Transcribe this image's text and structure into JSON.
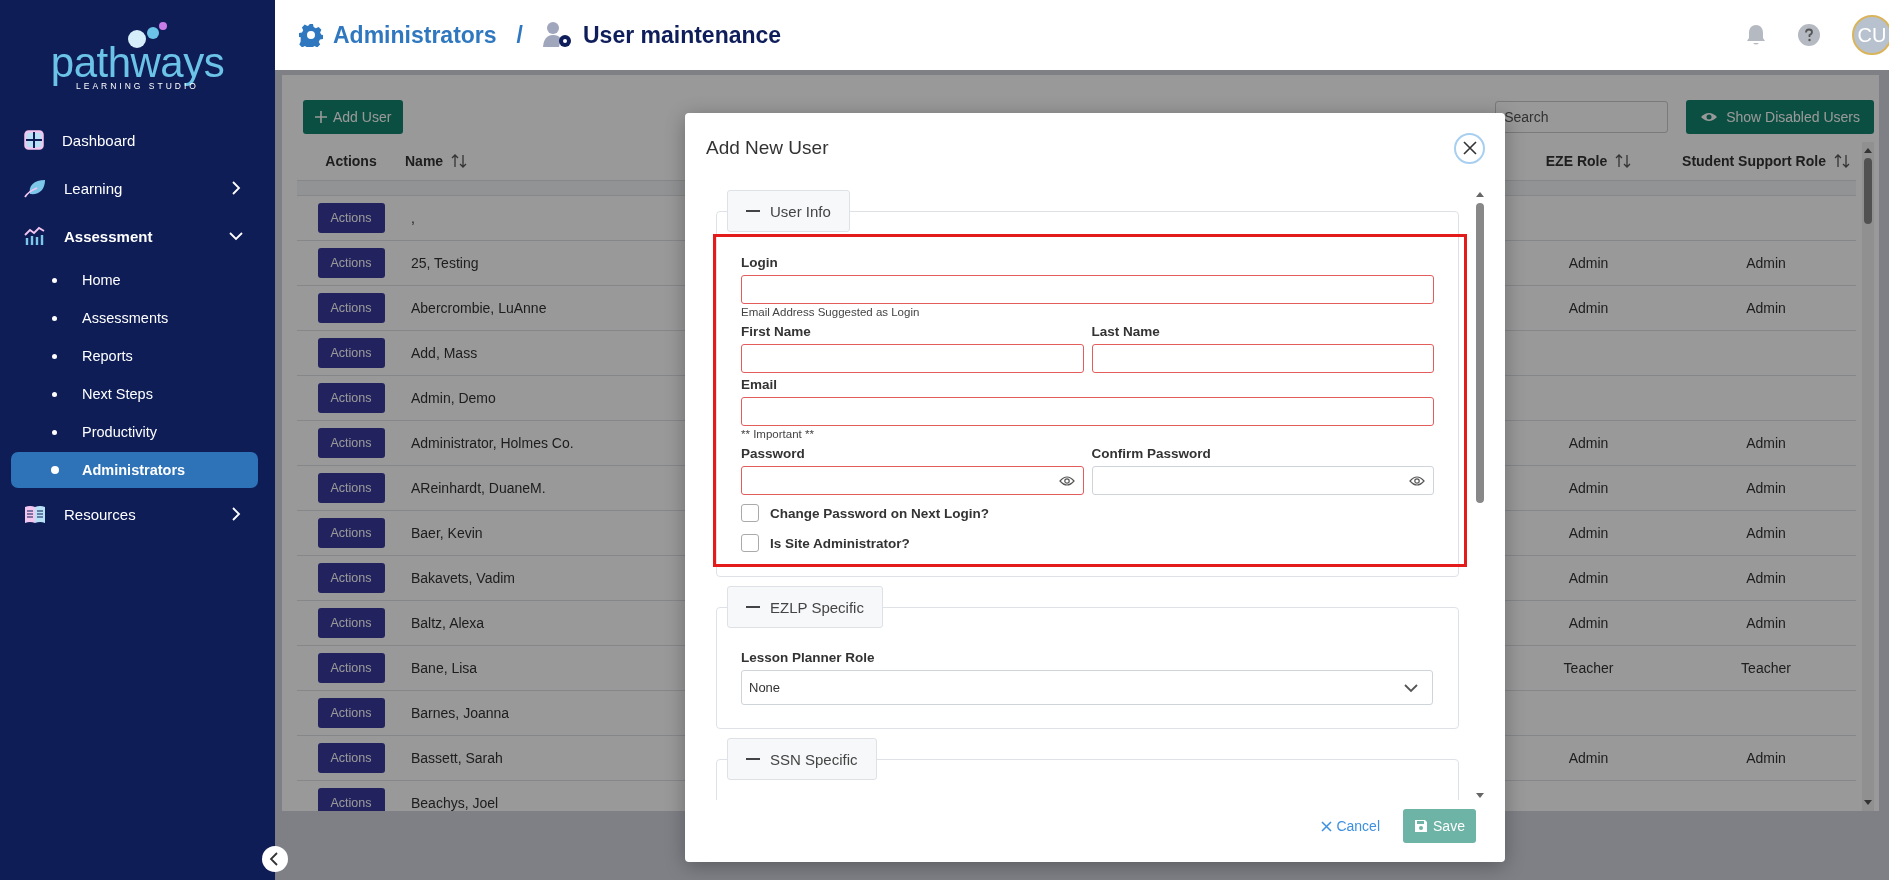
{
  "sidebar": {
    "logo": {
      "name": "pathways",
      "tagline": "LEARNING STUDIO"
    },
    "items": [
      {
        "label": "Dashboard"
      },
      {
        "label": "Learning",
        "expanded": false
      },
      {
        "label": "Assessment",
        "expanded": true,
        "children": [
          {
            "label": "Home",
            "selected": false
          },
          {
            "label": "Assessments",
            "selected": false
          },
          {
            "label": "Reports",
            "selected": false
          },
          {
            "label": "Next Steps",
            "selected": false
          },
          {
            "label": "Productivity",
            "selected": false
          },
          {
            "label": "Administrators",
            "selected": true
          }
        ]
      },
      {
        "label": "Resources",
        "expanded": false
      }
    ]
  },
  "header": {
    "breadcrumb": [
      {
        "label": "Administrators"
      },
      {
        "label": "User maintenance"
      }
    ],
    "separator": "/",
    "avatar": "CU"
  },
  "toolbar": {
    "add_button": "Add User",
    "search": {
      "placeholder": "Search"
    },
    "show_disabled_button": "Show Disabled Users"
  },
  "table": {
    "columns": [
      {
        "label": "Actions",
        "sortable": false
      },
      {
        "label": "Name",
        "sortable": true
      },
      {
        "label": "EZE Role",
        "sortable": true
      },
      {
        "label": "Student Support Role",
        "sortable": true
      }
    ],
    "rows": [
      {
        "action": "Actions",
        "name": ","
      },
      {
        "action": "Actions",
        "name": "25, Testing",
        "eze_role": "Admin",
        "support_role": "Admin"
      },
      {
        "action": "Actions",
        "name": "Abercrombie, LuAnne",
        "eze_role": "Admin",
        "support_role": "Admin"
      },
      {
        "action": "Actions",
        "name": "Add, Mass"
      },
      {
        "action": "Actions",
        "name": "Admin, Demo"
      },
      {
        "action": "Actions",
        "name": "Administrator, Holmes Co.",
        "eze_role": "Admin",
        "support_role": "Admin"
      },
      {
        "action": "Actions",
        "name": "AReinhardt, DuaneM.",
        "eze_role": "Admin",
        "support_role": "Admin"
      },
      {
        "action": "Actions",
        "name": "Baer, Kevin",
        "eze_role": "Admin",
        "support_role": "Admin"
      },
      {
        "action": "Actions",
        "name": "Bakavets, Vadim",
        "eze_role": "Admin",
        "support_role": "Admin"
      },
      {
        "action": "Actions",
        "name": "Baltz, Alexa",
        "eze_role": "Admin",
        "support_role": "Admin"
      },
      {
        "action": "Actions",
        "name": "Bane, Lisa",
        "eze_role": "Teacher",
        "support_role": "Teacher"
      },
      {
        "action": "Actions",
        "name": "Barnes, Joanna"
      },
      {
        "action": "Actions",
        "name": "Bassett, Sarah",
        "eze_role": "Admin",
        "support_role": "Admin"
      },
      {
        "action": "Actions",
        "name": "Beachys, Joel"
      }
    ]
  },
  "modal": {
    "title": "Add New User",
    "user_info": {
      "legend": "User Info",
      "expanded": true,
      "rows": [
        {
          "fields": [
            {
              "label": "Login",
              "kind": "text",
              "invalid": true
            }
          ],
          "hint": "Email Address Suggested as Login"
        },
        {
          "fields": [
            {
              "label": "First Name",
              "kind": "text",
              "invalid": true
            },
            {
              "label": "Last Name",
              "kind": "text",
              "invalid": true
            }
          ]
        },
        {
          "fields": [
            {
              "label": "Email",
              "kind": "text",
              "invalid": true
            }
          ],
          "hint": "** Important **"
        },
        {
          "fields": [
            {
              "label": "Password",
              "kind": "password",
              "invalid": true
            },
            {
              "label": "Confirm Password",
              "kind": "password",
              "invalid": false
            }
          ]
        }
      ],
      "checkboxes": [
        {
          "label": "Change Password on Next Login?",
          "checked": false
        },
        {
          "label": "Is Site Administrator?",
          "checked": false
        }
      ]
    },
    "ezlp": {
      "legend": "EZLP Specific",
      "expanded": true,
      "select": {
        "label": "Lesson Planner Role",
        "value": "None"
      }
    },
    "ssn": {
      "legend": "SSN Specific",
      "expanded": true
    },
    "footer": {
      "cancel": "Cancel",
      "save": {
        "label": "Save",
        "disabled": true
      }
    }
  }
}
